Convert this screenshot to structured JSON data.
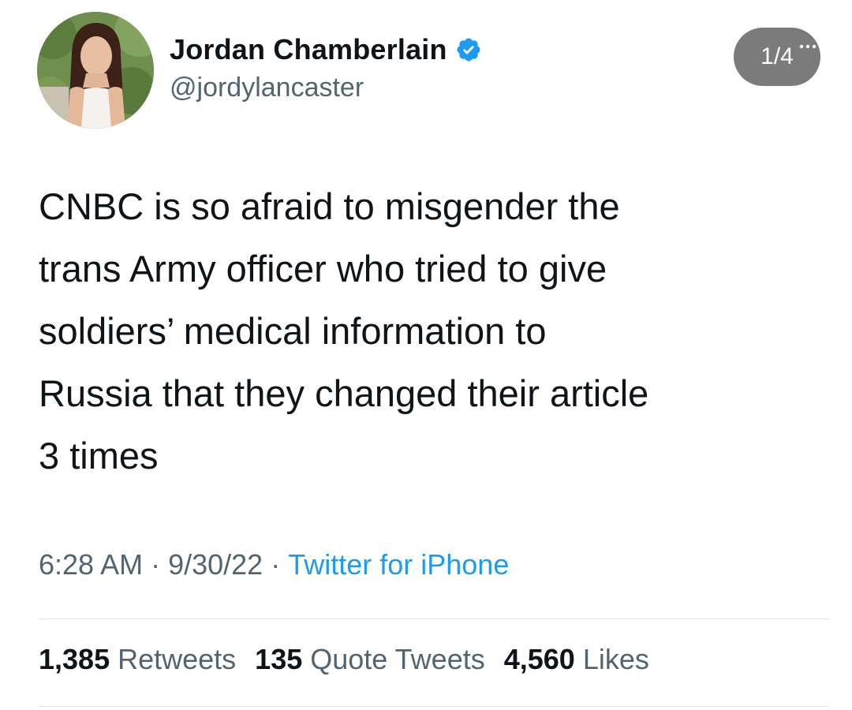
{
  "author": {
    "display_name": "Jordan Chamberlain",
    "handle": "@jordylancaster",
    "verified_icon": "verified-badge-icon",
    "verified_color": "#1d9bf0"
  },
  "media_counter": "1/4",
  "tweet": {
    "text": "CNBC is so afraid to misgender the\ntrans Army officer who tried to give\nsoldiers’ medical information to\nRussia that they changed their article\n3 times"
  },
  "meta": {
    "time": "6:28 AM",
    "separator": "·",
    "date": "9/30/22",
    "source": "Twitter for iPhone",
    "source_color": "#1d9bf0"
  },
  "stats": {
    "retweets_count": "1,385",
    "retweets_label": "Retweets",
    "quotes_count": "135",
    "quotes_label": "Quote Tweets",
    "likes_count": "4,560",
    "likes_label": "Likes"
  }
}
